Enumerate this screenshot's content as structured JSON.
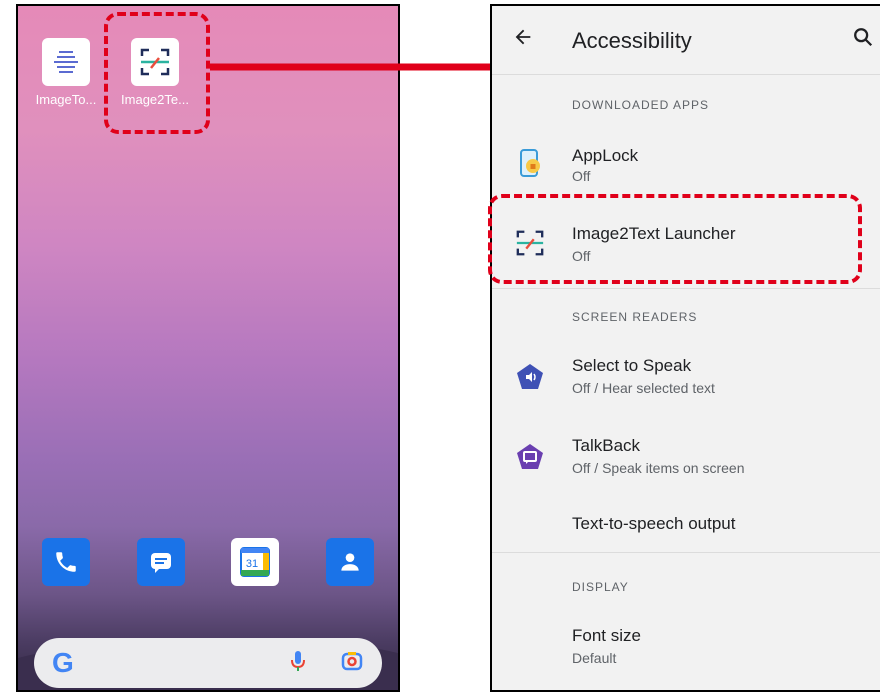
{
  "home": {
    "apps": [
      {
        "label": "ImageTo...",
        "icon": "image-to-text-app-icon"
      },
      {
        "label": "Image2Te...",
        "icon": "image2text-launcher-app-icon"
      }
    ],
    "dock": [
      {
        "icon": "phone-icon",
        "color": "#1a73e8"
      },
      {
        "icon": "messages-icon",
        "color": "#1a73e8"
      },
      {
        "icon": "calendar-icon",
        "color": "#ffffff",
        "text": "31"
      },
      {
        "icon": "contacts-icon",
        "color": "#1a73e8"
      }
    ],
    "search": {
      "logo": "G",
      "icons": [
        "mic-icon",
        "lens-icon"
      ]
    }
  },
  "settings": {
    "title": "Accessibility",
    "sections": {
      "downloaded": "DOWNLOADED APPS",
      "screen_readers": "SCREEN READERS",
      "display": "DISPLAY"
    },
    "items": [
      {
        "title": "AppLock",
        "subtitle": "Off",
        "icon": "applock-icon"
      },
      {
        "title": "Image2Text Launcher",
        "subtitle": "Off",
        "icon": "image2text-icon"
      },
      {
        "title": "Select to Speak",
        "subtitle": "Off / Hear selected text",
        "icon": "select-to-speak-icon"
      },
      {
        "title": "TalkBack",
        "subtitle": "Off / Speak items on screen",
        "icon": "talkback-icon"
      },
      {
        "title": "Text-to-speech output",
        "subtitle": "",
        "icon": ""
      },
      {
        "title": "Font size",
        "subtitle": "Default",
        "icon": ""
      }
    ]
  },
  "colors": {
    "highlight": "#e0001a",
    "accent": "#1a73e8",
    "talkback": "#6a3fb0",
    "select_to_speak": "#3f51b5"
  }
}
